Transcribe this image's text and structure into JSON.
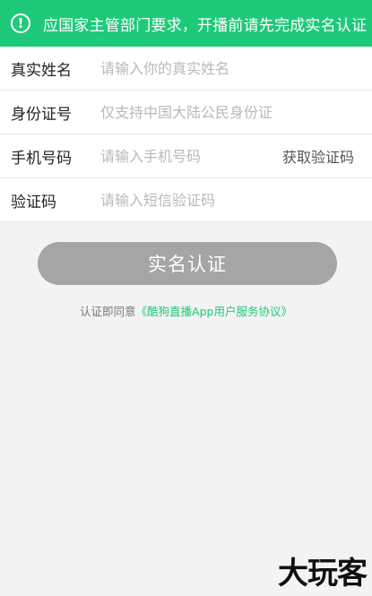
{
  "banner": {
    "icon": "exclamation-circle-icon",
    "text": "应国家主管部门要求，开播前请先完成实名认证",
    "background_color": "#1fc97a"
  },
  "form": {
    "name": {
      "label": "真实姓名",
      "placeholder": "请输入你的真实姓名"
    },
    "id_number": {
      "label": "身份证号",
      "placeholder": "仅支持中国大陆公民身份证"
    },
    "phone": {
      "label": "手机号码",
      "placeholder": "请输入手机号码",
      "get_code_label": "获取验证码"
    },
    "code": {
      "label": "验证码",
      "placeholder": "请输入短信验证码"
    }
  },
  "submit": {
    "label": "实名认证",
    "color": "#a5a5a5"
  },
  "agreement": {
    "prefix": "认证即同意",
    "link": "《酷狗直播App用户服务协议》",
    "link_color": "#1fc97a"
  },
  "watermark": {
    "text": "大玩客"
  }
}
